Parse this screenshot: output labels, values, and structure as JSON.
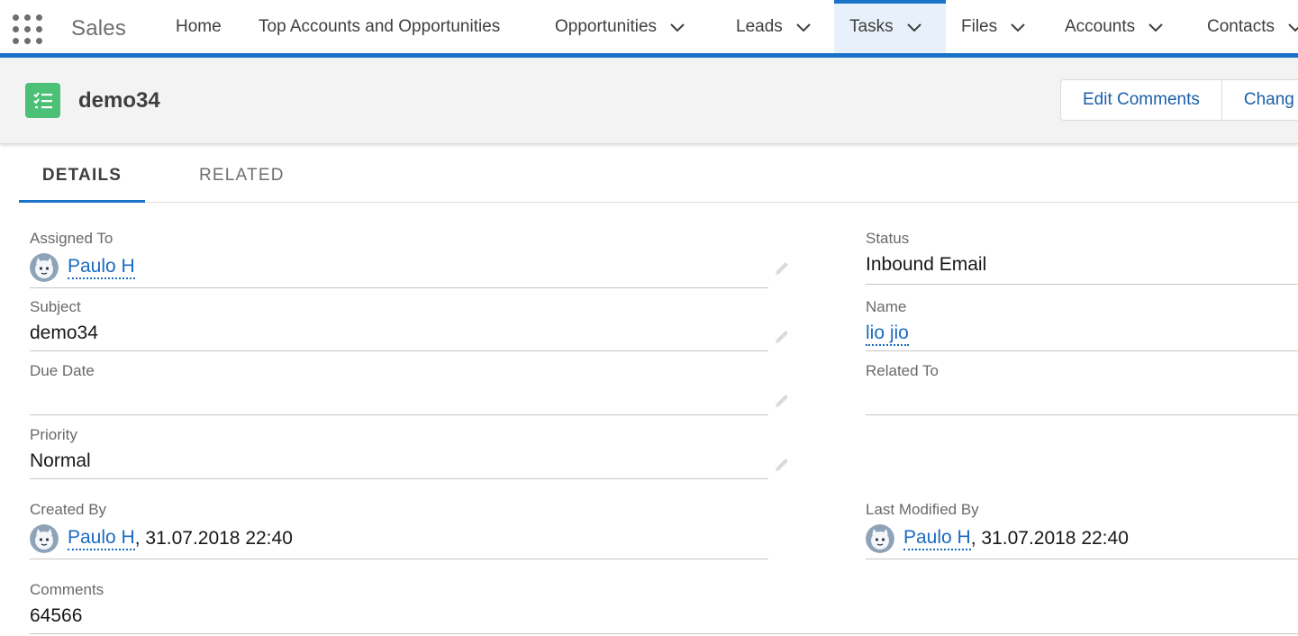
{
  "app": {
    "name": "Sales"
  },
  "nav": {
    "items": [
      {
        "label": "Home",
        "dropdown": false,
        "active": false
      },
      {
        "label": "Top Accounts and Opportunities",
        "dropdown": false,
        "active": false
      },
      {
        "label": "Opportunities",
        "dropdown": true,
        "active": false
      },
      {
        "label": "Leads",
        "dropdown": true,
        "active": false
      },
      {
        "label": "Tasks",
        "dropdown": true,
        "active": true
      },
      {
        "label": "Files",
        "dropdown": true,
        "active": false
      },
      {
        "label": "Accounts",
        "dropdown": true,
        "active": false
      },
      {
        "label": "Contacts",
        "dropdown": true,
        "active": false
      }
    ]
  },
  "record": {
    "icon": "task-icon",
    "title": "demo34",
    "actions": [
      "Edit Comments",
      "Chang"
    ]
  },
  "tabs": [
    "DETAILS",
    "RELATED"
  ],
  "fields": {
    "assigned_to": {
      "label": "Assigned To",
      "value": "Paulo H"
    },
    "subject": {
      "label": "Subject",
      "value": "demo34"
    },
    "due_date": {
      "label": "Due Date",
      "value": ""
    },
    "priority": {
      "label": "Priority",
      "value": "Normal"
    },
    "created_by": {
      "label": "Created By",
      "user": "Paulo H",
      "suffix": ", 31.07.2018 22:40"
    },
    "comments": {
      "label": "Comments",
      "value": "64566"
    },
    "status": {
      "label": "Status",
      "value": "Inbound Email"
    },
    "name": {
      "label": "Name",
      "value": "lio jio"
    },
    "related_to": {
      "label": "Related To",
      "value": ""
    },
    "last_modified_by": {
      "label": "Last Modified By",
      "user": "Paulo H",
      "suffix": ", 31.07.2018 22:40"
    }
  },
  "colors": {
    "brand": "#1b73c9",
    "task_icon": "#4bc076",
    "link": "#1b6bc0"
  }
}
